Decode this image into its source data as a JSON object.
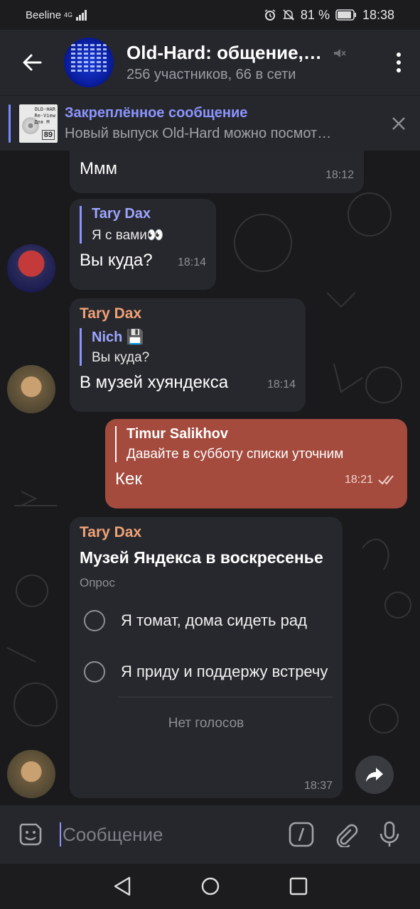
{
  "statusbar": {
    "carrier": "Beeline",
    "network": "4G",
    "battery": "81 %",
    "time": "18:38"
  },
  "header": {
    "title": "Old-Hard: общение,…",
    "subtitle": "256 участников, 66 в сети"
  },
  "pinned": {
    "label": "Закреплённое сообщение",
    "text": "Новый выпуск Old-Hard можно посмот…",
    "thumb_text": "OLD-HAR\nRe-View\nДля М",
    "thumb_num": "89"
  },
  "messages": [
    {
      "text": "Ммм",
      "time": "18:12"
    },
    {
      "reply_name": "Tary Dax",
      "reply_text": "Я с вами👀",
      "text": "Вы куда?",
      "time": "18:14"
    },
    {
      "sender": "Tary Dax",
      "reply_name": "Nich 💾",
      "reply_text": "Вы куда?",
      "text": "В музей хуяндекса",
      "time": "18:14"
    },
    {
      "reply_name": "Timur Salikhov",
      "reply_text": "Давайте в субботу списки уточним",
      "text": "Кек",
      "time": "18:21"
    }
  ],
  "poll": {
    "sender": "Tary Dax",
    "question": "Музей Яндекса в воскресенье",
    "type": "Опрос",
    "options": [
      "Я томат, дома сидеть рад",
      "Я приду и поддержу встречу"
    ],
    "footer": "Нет голосов",
    "time": "18:37"
  },
  "input": {
    "placeholder": "Сообщение"
  },
  "colors": {
    "accent": "#8b95ff",
    "sender_name": "#f0a277",
    "outgoing_bubble": "#a44b3e",
    "incoming_bubble": "#27282d"
  }
}
